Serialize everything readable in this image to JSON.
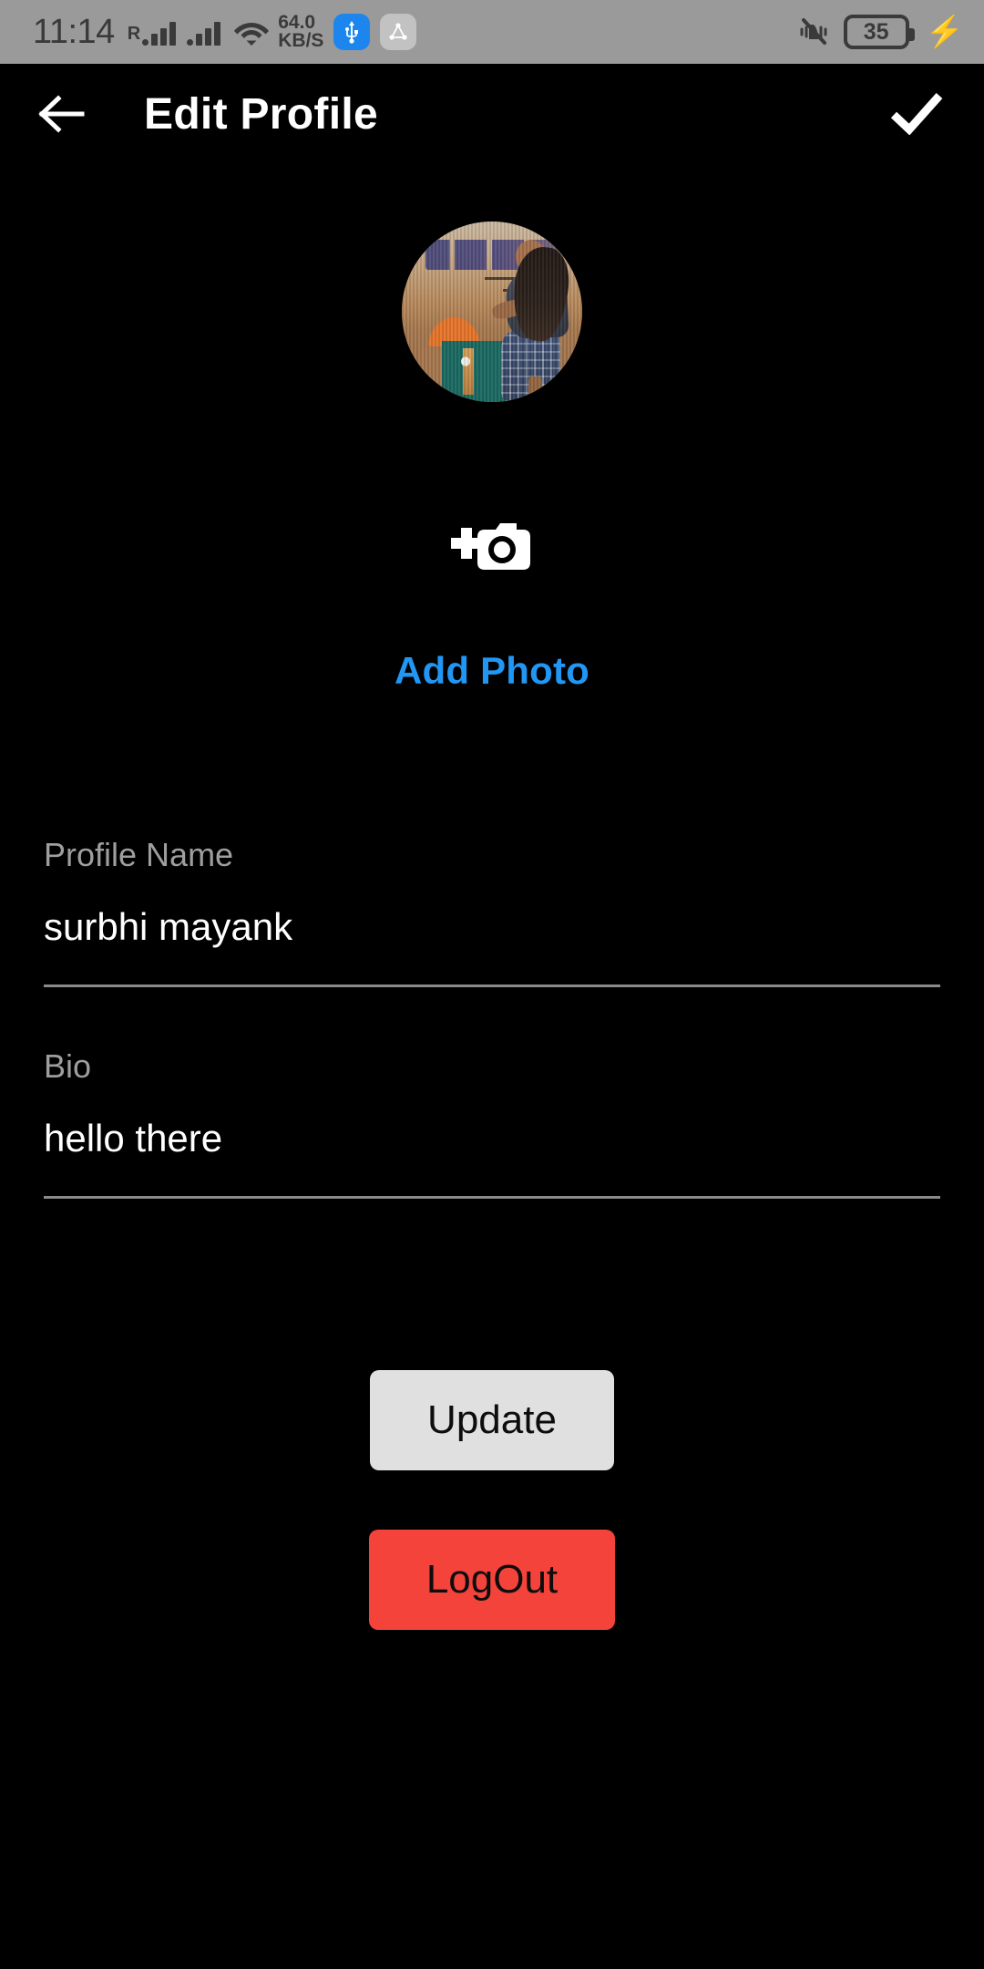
{
  "statusbar": {
    "time": "11:14",
    "roaming_label": "R",
    "network_speed": "64.0",
    "network_speed_unit": "KB/S",
    "battery_level": "35",
    "icons": {
      "signal_1": "signal-bars-icon",
      "signal_2": "signal-bars-icon",
      "wifi": "wifi-icon",
      "usb": "usb-icon",
      "app_badge": "share-nodes-icon",
      "mute": "ringer-silent-icon",
      "battery": "battery-icon",
      "charging": "charging-bolt-icon"
    },
    "bg_color": "#9a9a9a",
    "fg_color": "#3a3a3a",
    "usb_badge_color": "#1c86ee",
    "app_badge_color": "#c2c2c2"
  },
  "appbar": {
    "back_icon": "arrow-left-icon",
    "title": "Edit Profile",
    "confirm_icon": "check-icon",
    "bg_color": "#000000",
    "fg_color": "#ffffff"
  },
  "profile": {
    "avatar_alt": "profile-photo",
    "camera_icon": "add-a-photo-icon",
    "add_photo_label": "Add Photo",
    "add_photo_color": "#2196f3"
  },
  "form": {
    "fields": [
      {
        "label": "Profile Name",
        "value": "surbhi mayank",
        "placeholder": "Profile Name"
      },
      {
        "label": "Bio",
        "value": "hello there",
        "placeholder": "Bio"
      }
    ]
  },
  "actions": {
    "update_label": "Update",
    "update_bg": "#e0e0e0",
    "logout_label": "LogOut",
    "logout_bg": "#f4433a"
  }
}
